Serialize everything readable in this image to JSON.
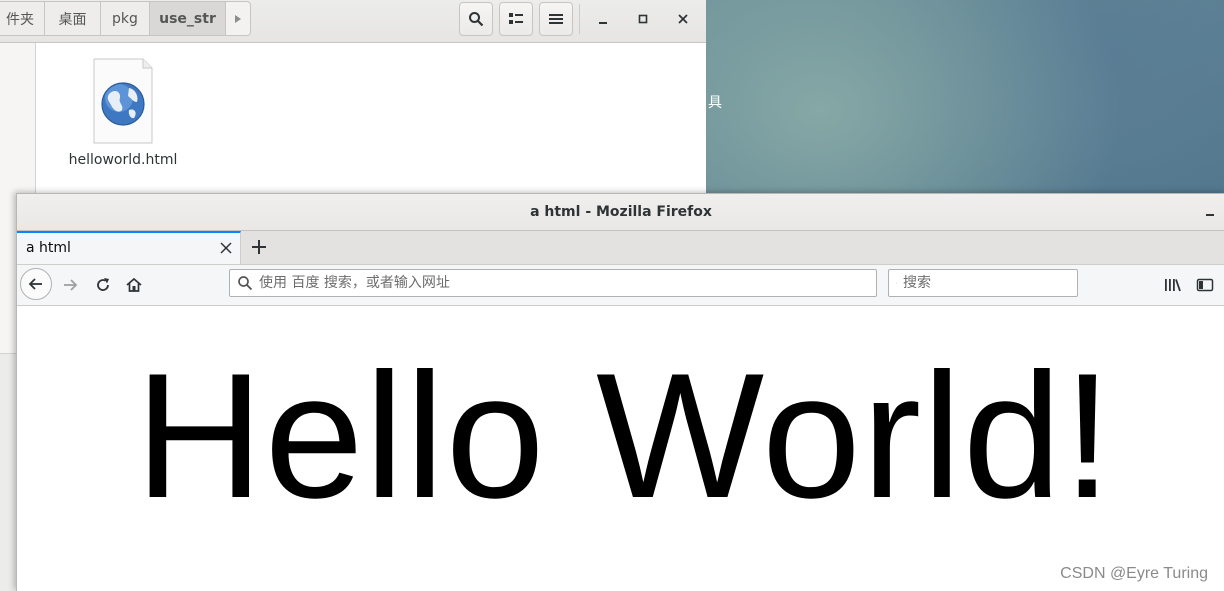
{
  "desktop": {
    "label_fragment": "具"
  },
  "file_manager": {
    "breadcrumbs": [
      "件夹",
      "桌面",
      "pkg",
      "use_str"
    ],
    "active_crumb": "use_str",
    "toolbar": {
      "search_icon": "search-icon",
      "view_icon": "list-view-icon",
      "menu_icon": "hamburger-menu-icon"
    },
    "window_controls": [
      "minimize",
      "maximize",
      "close"
    ],
    "files": [
      {
        "name": "helloworld.html",
        "icon": "html-globe-icon"
      }
    ]
  },
  "firefox": {
    "window_title": "a html - Mozilla Firefox",
    "tabs": [
      {
        "label": "a html",
        "active": true
      }
    ],
    "urlbar": {
      "placeholder": "使用 百度 搜索，或者输入网址",
      "value": ""
    },
    "searchbar": {
      "placeholder": "搜索",
      "value": ""
    },
    "content": {
      "heading": "Hello World!"
    },
    "accent": "#0a84ff"
  },
  "watermark": "CSDN @Eyre Turing"
}
